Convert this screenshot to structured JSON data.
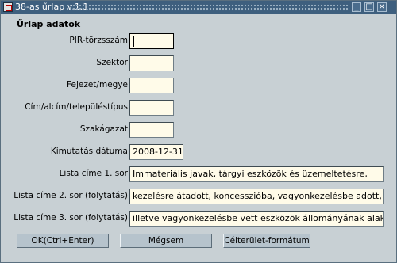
{
  "window": {
    "title": "38-as űrlap v.1.1"
  },
  "titlebar_buttons": [
    "minimize-icon",
    "maximize-icon",
    "close-icon"
  ],
  "form": {
    "section_title": "Űrlap adatok",
    "fields": [
      {
        "label": "PIR-törzsszám",
        "value": ""
      },
      {
        "label": "Szektor",
        "value": ""
      },
      {
        "label": "Fejezet/megye",
        "value": ""
      },
      {
        "label": "Cím/alcím/településtípus",
        "value": ""
      },
      {
        "label": "Szakágazat",
        "value": ""
      },
      {
        "label": "Kimutatás dátuma",
        "value": "2008-12-31"
      },
      {
        "label": "Lista címe 1. sor",
        "value": "Immateriális javak, tárgyi eszközök és üzemeltetésre,"
      },
      {
        "label": "Lista címe 2. sor (folytatás)",
        "value": "kezelésre átadott, koncesszióba, vagyonkezelésbe adott,"
      },
      {
        "label": "Lista címe 3. sor (folytatás)",
        "value": "illetve vagyonkezelésbe vett eszközök állományának alakulása"
      }
    ]
  },
  "buttons": {
    "ok": "OK(Ctrl+Enter)",
    "cancel": "Mégsem",
    "target_format": "Célterület-formátum"
  },
  "colors": {
    "titlebar": "#3e5f7e",
    "field_bg": "#fffbe9",
    "window_bg": "#c8d0d4"
  }
}
